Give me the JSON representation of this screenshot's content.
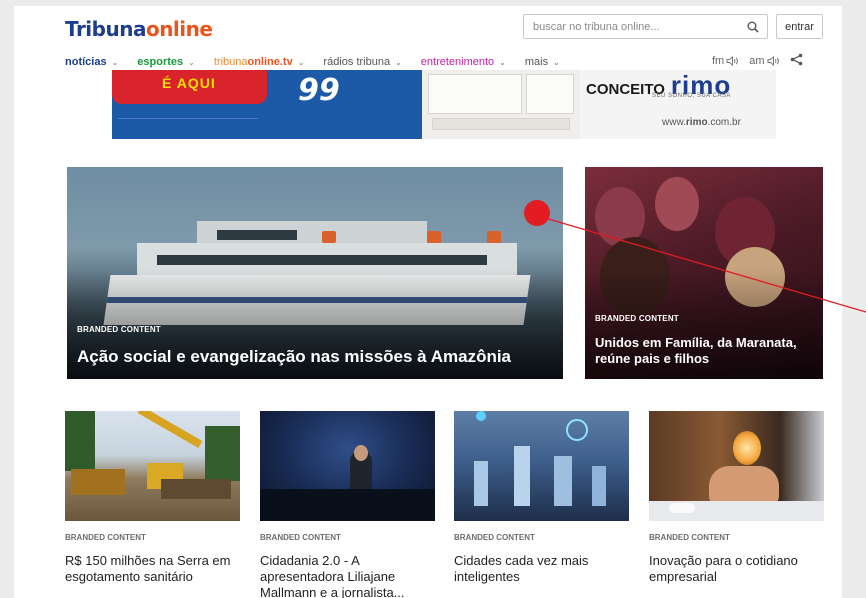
{
  "header": {
    "logo_part1": "Tribuna",
    "logo_part2": "online",
    "search_placeholder": "buscar no tribuna online...",
    "login_label": "entrar"
  },
  "nav": {
    "items": [
      {
        "label": "notícias",
        "color": "#1d3d8f"
      },
      {
        "label": "esportes",
        "color": "#1a9a3a"
      },
      {
        "label_a": "tribuna",
        "label_b": "online.tv",
        "color_a": "#f08a2b",
        "color_b": "#e8541e"
      },
      {
        "label": "rádios tribuna",
        "color": "#555555"
      },
      {
        "label": "entretenimento",
        "color": "#c51fa8"
      },
      {
        "label": "mais",
        "color": "#555555"
      }
    ],
    "radio_fm": "fm",
    "radio_am": "am"
  },
  "ad": {
    "slogan_left": "É AQUI",
    "price": "99",
    "brand_prefix": "CONCEITO",
    "brand_name": "rimo",
    "tagline": "SEU SONHO, SUA CASA",
    "url_prefix": "www.",
    "url_bold": "rimo",
    "url_suffix": ".com.br"
  },
  "features": [
    {
      "kicker": "BRANDED CONTENT",
      "headline": "Ação social e evangelização nas missões à Amazônia"
    },
    {
      "kicker": "BRANDED CONTENT",
      "headline": "Unidos em Família, da Maranata, reúne pais e filhos"
    }
  ],
  "articles": [
    {
      "kicker": "BRANDED CONTENT",
      "title": "R$ 150 milhões na Serra em esgotamento sanitário"
    },
    {
      "kicker": "BRANDED CONTENT",
      "title": "Cidadania 2.0 - A apresentadora Liliajane Mallmann e a jornalista..."
    },
    {
      "kicker": "BRANDED CONTENT",
      "title": "Cidades cada vez mais inteligentes"
    },
    {
      "kicker": "BRANDED CONTENT",
      "title": "Inovação para o cotidiano empresarial"
    }
  ],
  "colors": {
    "brand_blue": "#1d3d8f",
    "brand_orange": "#e8541e",
    "marker_red": "#e31b23"
  }
}
